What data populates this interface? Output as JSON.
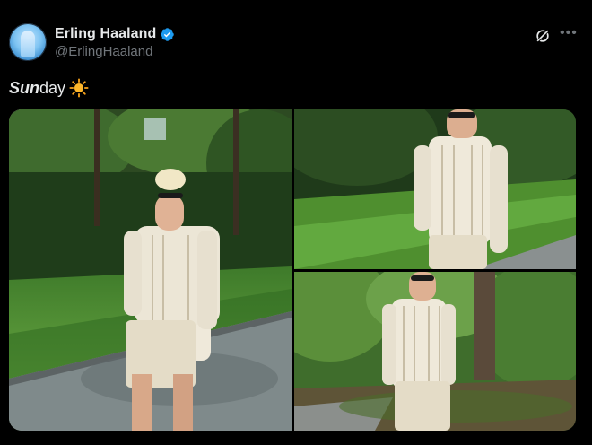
{
  "author": {
    "display_name": "Erling Haaland",
    "handle": "@ErlingHaaland",
    "verified": true,
    "avatar_icon": "avatar-photo"
  },
  "actions": {
    "grok_icon": "grok-icon",
    "more_icon": "more-options-icon"
  },
  "tweet": {
    "text_emphasis": "Sun",
    "text_rest": "day",
    "emoji": "sun-emoji"
  },
  "media": {
    "count": 3,
    "photos": [
      {
        "alt": "photo-1"
      },
      {
        "alt": "photo-2"
      },
      {
        "alt": "photo-3"
      }
    ]
  },
  "colors": {
    "background": "#000000",
    "text": "#e7e9ea",
    "secondary_text": "#71767b",
    "verified_blue": "#1d9bf0",
    "sun_orange": "#f7a21b"
  }
}
